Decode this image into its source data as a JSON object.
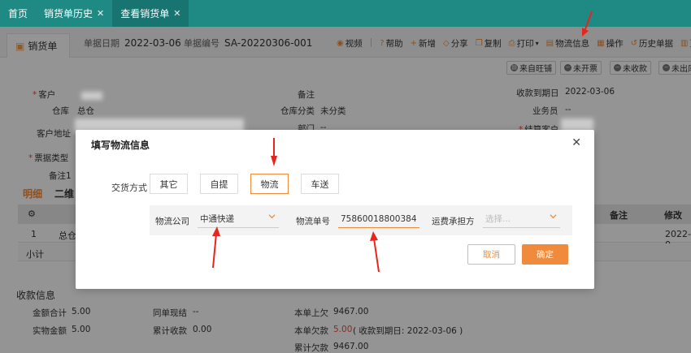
{
  "tabs": [
    {
      "label": "首页",
      "closable": false,
      "active": false
    },
    {
      "label": "销货单历史",
      "closable": true,
      "active": false
    },
    {
      "label": "查看销货单",
      "closable": true,
      "active": true
    }
  ],
  "doc": {
    "tab_label": "销货单",
    "date_label": "单据日期",
    "date_value": "2022-03-06",
    "no_label": "单据编号",
    "no_value": "SA-20220306-001"
  },
  "toolbar": {
    "video": "视频",
    "help": "帮助",
    "add": "新增",
    "share": "分享",
    "copy": "复制",
    "print": "打印",
    "logistics": "物流信息",
    "operate": "操作",
    "history": "历史单据",
    "more": "更"
  },
  "status": {
    "source": "来自旺铺",
    "invoice": "未开票",
    "collect": "未收款",
    "outbound": "未出库"
  },
  "form": {
    "customer_label": "客户",
    "warehouse_label": "仓库",
    "warehouse_value": "总仓",
    "address_label": "客户地址",
    "receipt_type_label": "票据类型",
    "remark1_label": "备注1",
    "remark_label": "备注",
    "wh_category_label": "仓库分类",
    "wh_category_value": "未分类",
    "dept_label": "部门",
    "dept_value": "--",
    "due_label": "收款到期日",
    "due_value": "2022-03-06",
    "salesman_label": "业务员",
    "salesman_value": "--",
    "settle_label": "结算客户"
  },
  "lower_tabs": {
    "detail": "明细",
    "dimension": "二维"
  },
  "grid": {
    "remark_col": "备注",
    "modify_col": "修改",
    "row1_no": "1",
    "row1_wh": "总仓",
    "row1_date": "2022-0",
    "subtotal": "小计"
  },
  "summary": {
    "title": "收款信息",
    "amount_total_label": "金额合计",
    "amount_total_value": "5.00",
    "paid_label": "实物金额",
    "paid_value": "5.00",
    "same_bill_label": "同单现结",
    "same_bill_value": "--",
    "cum_receipt_label": "累计收款",
    "cum_receipt_value": "0.00",
    "prev_owed_label": "本单上欠",
    "prev_owed_value": "9467.00",
    "this_owed_label": "本单欠款",
    "this_owed_value": "5.00",
    "this_owed_note": "( 收款到期日: 2022-03-06 )",
    "cum_owed_label": "累计欠款",
    "cum_owed_value": "9467.00"
  },
  "modal": {
    "title": "填写物流信息",
    "mode_label": "交货方式",
    "modes": [
      "其它",
      "自提",
      "物流",
      "车送"
    ],
    "active_mode": "物流",
    "company_label": "物流公司",
    "company_value": "中通快递",
    "tracking_label": "物流单号",
    "tracking_value": "75860018800384",
    "payer_label": "运费承担方",
    "payer_placeholder": "选择...",
    "cancel": "取消",
    "ok": "确定"
  },
  "colors": {
    "teal": "#1f8a83",
    "orange": "#f08a3c",
    "annotation_red": "#e8251c"
  }
}
